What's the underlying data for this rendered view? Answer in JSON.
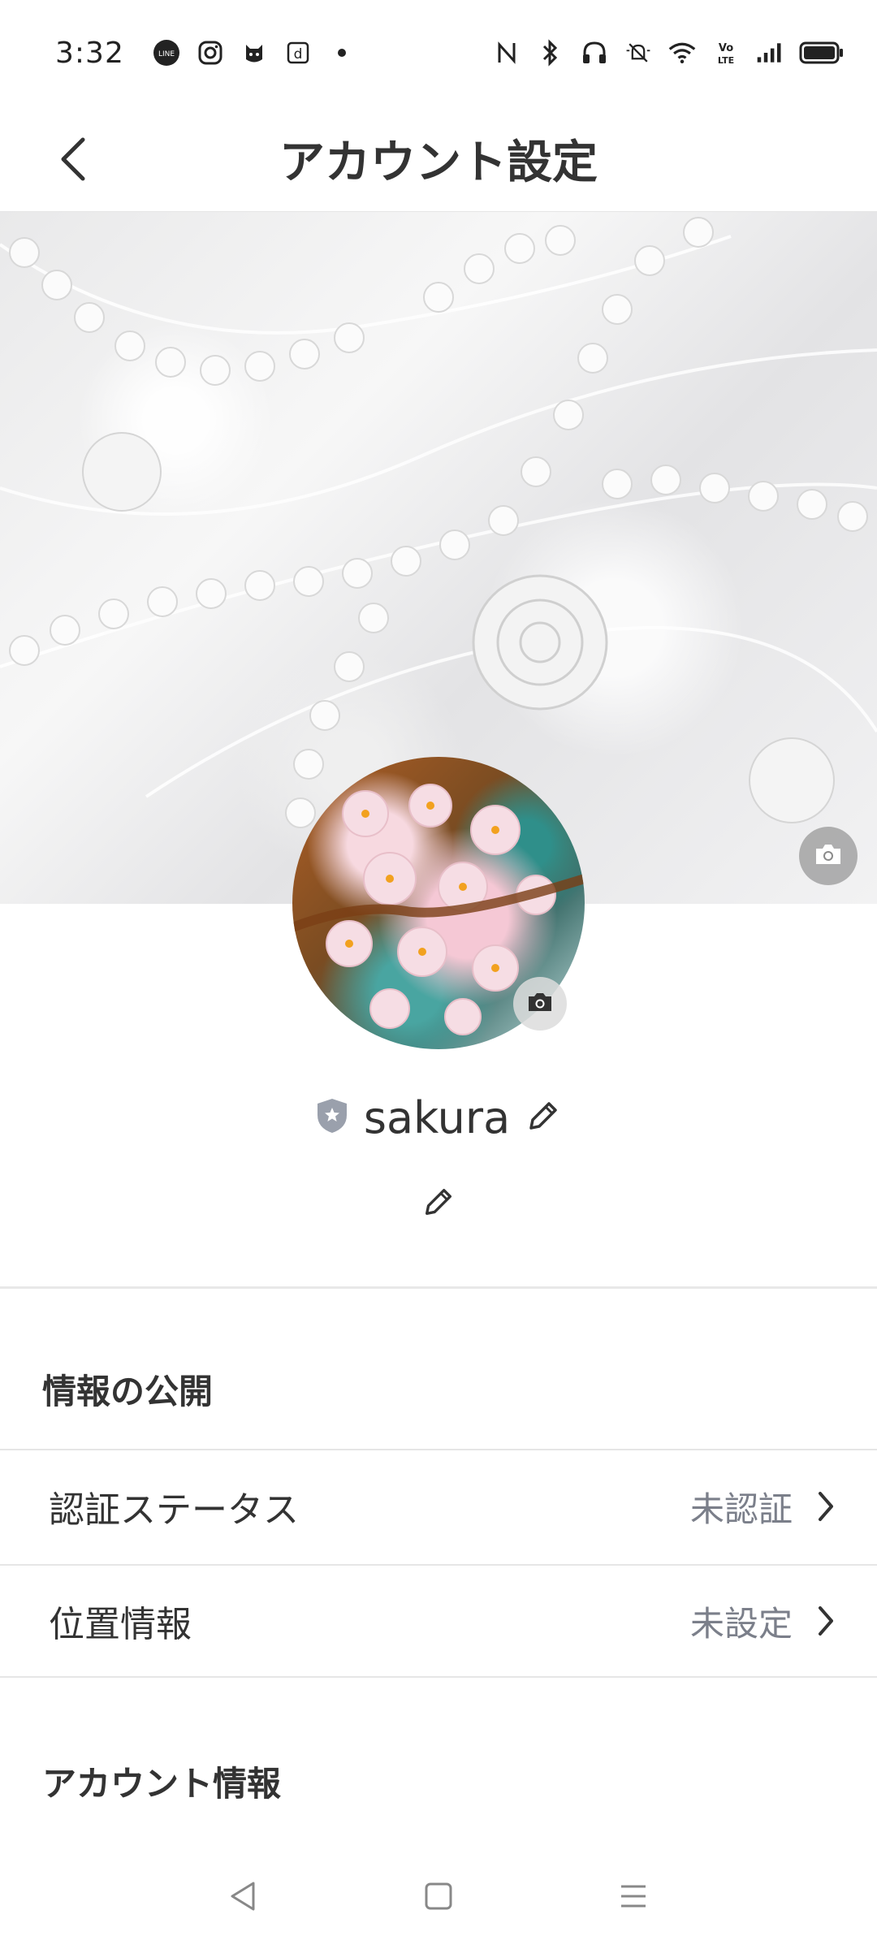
{
  "status_bar": {
    "time": "3:32",
    "notification_icons": [
      "line-icon",
      "instagram-icon",
      "app-icon",
      "d-app-icon",
      "dot-icon"
    ],
    "system_icons": [
      "nfc-icon",
      "bluetooth-icon",
      "headphones-icon",
      "mute-icon",
      "wifi-icon",
      "volte-icon",
      "signal-icon",
      "battery-icon"
    ]
  },
  "header": {
    "title": "アカウント設定",
    "back_icon": "chevron-left-icon"
  },
  "profile": {
    "username": "sakura",
    "badge_icon": "shield-star-icon",
    "edit_icon": "pencil-icon"
  },
  "sections": {
    "info_public": {
      "title": "情報の公開",
      "rows": [
        {
          "label": "認証ステータス",
          "value": "未認証"
        },
        {
          "label": "位置情報",
          "value": "未設定"
        }
      ]
    },
    "account_info": {
      "title": "アカウント情報"
    }
  },
  "nav_bar": {
    "back": "triangle-back-icon",
    "home": "square-home-icon",
    "menu": "menu-lines-icon"
  },
  "colors": {
    "text": "#333333",
    "value_text": "#7b7f8a",
    "divider": "#e6e6e6",
    "badge": "#9aa0ac"
  }
}
